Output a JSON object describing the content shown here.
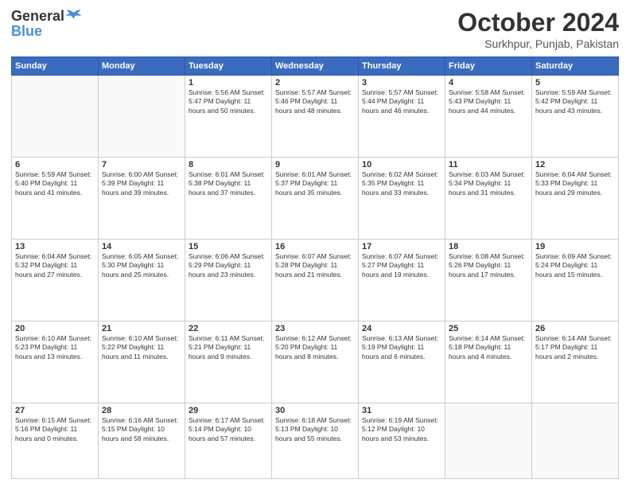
{
  "header": {
    "logo_general": "General",
    "logo_blue": "Blue",
    "month_title": "October 2024",
    "location": "Surkhpur, Punjab, Pakistan"
  },
  "days_of_week": [
    "Sunday",
    "Monday",
    "Tuesday",
    "Wednesday",
    "Thursday",
    "Friday",
    "Saturday"
  ],
  "weeks": [
    [
      {
        "day": "",
        "info": ""
      },
      {
        "day": "",
        "info": ""
      },
      {
        "day": "1",
        "info": "Sunrise: 5:56 AM\nSunset: 5:47 PM\nDaylight: 11 hours and 50 minutes."
      },
      {
        "day": "2",
        "info": "Sunrise: 5:57 AM\nSunset: 5:46 PM\nDaylight: 11 hours and 48 minutes."
      },
      {
        "day": "3",
        "info": "Sunrise: 5:57 AM\nSunset: 5:44 PM\nDaylight: 11 hours and 46 minutes."
      },
      {
        "day": "4",
        "info": "Sunrise: 5:58 AM\nSunset: 5:43 PM\nDaylight: 11 hours and 44 minutes."
      },
      {
        "day": "5",
        "info": "Sunrise: 5:59 AM\nSunset: 5:42 PM\nDaylight: 11 hours and 43 minutes."
      }
    ],
    [
      {
        "day": "6",
        "info": "Sunrise: 5:59 AM\nSunset: 5:40 PM\nDaylight: 11 hours and 41 minutes."
      },
      {
        "day": "7",
        "info": "Sunrise: 6:00 AM\nSunset: 5:39 PM\nDaylight: 11 hours and 39 minutes."
      },
      {
        "day": "8",
        "info": "Sunrise: 6:01 AM\nSunset: 5:38 PM\nDaylight: 11 hours and 37 minutes."
      },
      {
        "day": "9",
        "info": "Sunrise: 6:01 AM\nSunset: 5:37 PM\nDaylight: 11 hours and 35 minutes."
      },
      {
        "day": "10",
        "info": "Sunrise: 6:02 AM\nSunset: 5:35 PM\nDaylight: 11 hours and 33 minutes."
      },
      {
        "day": "11",
        "info": "Sunrise: 6:03 AM\nSunset: 5:34 PM\nDaylight: 11 hours and 31 minutes."
      },
      {
        "day": "12",
        "info": "Sunrise: 6:04 AM\nSunset: 5:33 PM\nDaylight: 11 hours and 29 minutes."
      }
    ],
    [
      {
        "day": "13",
        "info": "Sunrise: 6:04 AM\nSunset: 5:32 PM\nDaylight: 11 hours and 27 minutes."
      },
      {
        "day": "14",
        "info": "Sunrise: 6:05 AM\nSunset: 5:30 PM\nDaylight: 11 hours and 25 minutes."
      },
      {
        "day": "15",
        "info": "Sunrise: 6:06 AM\nSunset: 5:29 PM\nDaylight: 11 hours and 23 minutes."
      },
      {
        "day": "16",
        "info": "Sunrise: 6:07 AM\nSunset: 5:28 PM\nDaylight: 11 hours and 21 minutes."
      },
      {
        "day": "17",
        "info": "Sunrise: 6:07 AM\nSunset: 5:27 PM\nDaylight: 11 hours and 19 minutes."
      },
      {
        "day": "18",
        "info": "Sunrise: 6:08 AM\nSunset: 5:26 PM\nDaylight: 11 hours and 17 minutes."
      },
      {
        "day": "19",
        "info": "Sunrise: 6:09 AM\nSunset: 5:24 PM\nDaylight: 11 hours and 15 minutes."
      }
    ],
    [
      {
        "day": "20",
        "info": "Sunrise: 6:10 AM\nSunset: 5:23 PM\nDaylight: 11 hours and 13 minutes."
      },
      {
        "day": "21",
        "info": "Sunrise: 6:10 AM\nSunset: 5:22 PM\nDaylight: 11 hours and 11 minutes."
      },
      {
        "day": "22",
        "info": "Sunrise: 6:11 AM\nSunset: 5:21 PM\nDaylight: 11 hours and 9 minutes."
      },
      {
        "day": "23",
        "info": "Sunrise: 6:12 AM\nSunset: 5:20 PM\nDaylight: 11 hours and 8 minutes."
      },
      {
        "day": "24",
        "info": "Sunrise: 6:13 AM\nSunset: 5:19 PM\nDaylight: 11 hours and 6 minutes."
      },
      {
        "day": "25",
        "info": "Sunrise: 6:14 AM\nSunset: 5:18 PM\nDaylight: 11 hours and 4 minutes."
      },
      {
        "day": "26",
        "info": "Sunrise: 6:14 AM\nSunset: 5:17 PM\nDaylight: 11 hours and 2 minutes."
      }
    ],
    [
      {
        "day": "27",
        "info": "Sunrise: 6:15 AM\nSunset: 5:16 PM\nDaylight: 11 hours and 0 minutes."
      },
      {
        "day": "28",
        "info": "Sunrise: 6:16 AM\nSunset: 5:15 PM\nDaylight: 10 hours and 58 minutes."
      },
      {
        "day": "29",
        "info": "Sunrise: 6:17 AM\nSunset: 5:14 PM\nDaylight: 10 hours and 57 minutes."
      },
      {
        "day": "30",
        "info": "Sunrise: 6:18 AM\nSunset: 5:13 PM\nDaylight: 10 hours and 55 minutes."
      },
      {
        "day": "31",
        "info": "Sunrise: 6:19 AM\nSunset: 5:12 PM\nDaylight: 10 hours and 53 minutes."
      },
      {
        "day": "",
        "info": ""
      },
      {
        "day": "",
        "info": ""
      }
    ]
  ]
}
